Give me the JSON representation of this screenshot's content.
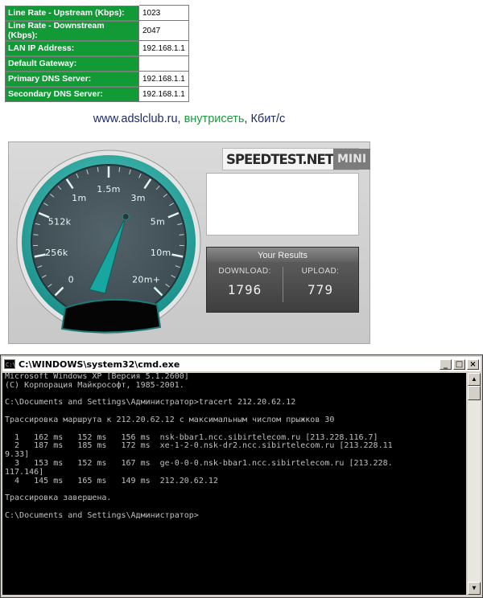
{
  "modem_stats": [
    {
      "label": "Line Rate - Upstream (Kbps):",
      "value": "1023"
    },
    {
      "label": "Line Rate - Downstream (Kbps):",
      "value": "2047"
    },
    {
      "label": "LAN IP Address:",
      "value": "192.168.1.1"
    },
    {
      "label": "Default Gateway:",
      "value": ""
    },
    {
      "label": "Primary DNS Server:",
      "value": "192.168.1.1"
    },
    {
      "label": "Secondary DNS Server:",
      "value": "192.168.1.1"
    }
  ],
  "caption": {
    "site": "www.adslclub.ru, ",
    "network": "внутрисеть",
    "unit": ", Кбит/с"
  },
  "speedtest": {
    "brand": "SPEEDTEST.NET",
    "edition": "MINI",
    "results_title": "Your Results",
    "download_label": "DOWNLOAD:",
    "upload_label": "UPLOAD:",
    "download_value": "1796",
    "upload_value": "779",
    "gauge_labels": [
      "0",
      "256k",
      "512k",
      "1m",
      "1.5m",
      "3m",
      "5m",
      "10m",
      "20m+"
    ],
    "colors": {
      "gauge_ring": "#1a8f8a",
      "gauge_face": "#3c4a50",
      "needle": "#17a7a0"
    }
  },
  "cmd": {
    "title": "C:\\WINDOWS\\system32\\cmd.exe",
    "lines": [
      "Microsoft Windows XP [Версия 5.1.2600]",
      "(С) Корпорация Майкрософт, 1985-2001.",
      "",
      "C:\\Documents and Settings\\Администратор>tracert 212.20.62.12",
      "",
      "Трассировка маршрута к 212.20.62.12 с максимальным числом прыжков 30",
      "",
      "  1   162 ms   152 ms   156 ms  nsk-bbar1.ncc.sibirtelecom.ru [213.228.116.7]",
      "  2   187 ms   185 ms   172 ms  xe-1-2-0.nsk-dr2.ncc.sibirtelecom.ru [213.228.11",
      "9.33]",
      "  3   153 ms   152 ms   167 ms  ge-0-0-0.nsk-bbar1.ncc.sibirtelecom.ru [213.228.",
      "117.146]",
      "  4   145 ms   165 ms   149 ms  212.20.62.12",
      "",
      "Трассировка завершена.",
      "",
      "C:\\Documents and Settings\\Администратор>"
    ]
  }
}
